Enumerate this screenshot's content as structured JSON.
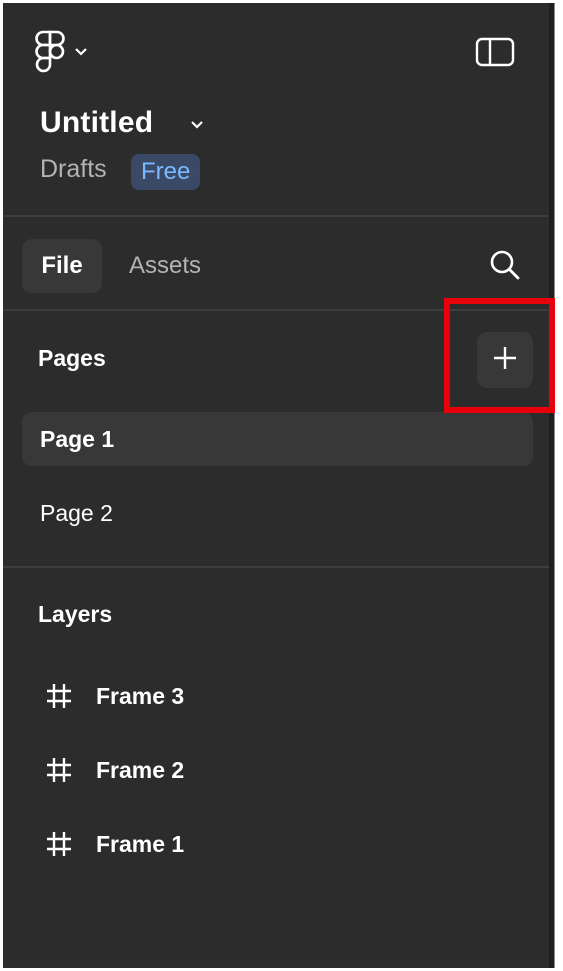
{
  "header": {
    "logo_icon": "figma-logo-icon",
    "menu_chevron_icon": "chevron-down-icon",
    "sidebar_toggle_icon": "sidebar-toggle-icon",
    "file_title": "Untitled",
    "title_chevron_icon": "chevron-down-icon",
    "location": "Drafts",
    "plan_badge": "Free"
  },
  "tabs": {
    "items": [
      {
        "label": "File",
        "active": true
      },
      {
        "label": "Assets",
        "active": false
      }
    ],
    "search_icon": "search-icon"
  },
  "pages": {
    "title": "Pages",
    "add_icon": "plus-icon",
    "items": [
      {
        "label": "Page 1",
        "selected": true
      },
      {
        "label": "Page 2",
        "selected": false
      }
    ]
  },
  "layers": {
    "title": "Layers",
    "items": [
      {
        "label": "Frame 3",
        "icon": "frame-icon"
      },
      {
        "label": "Frame 2",
        "icon": "frame-icon"
      },
      {
        "label": "Frame 1",
        "icon": "frame-icon"
      }
    ]
  },
  "colors": {
    "panel_bg": "#2c2c2c",
    "selected_bg": "#383838",
    "badge_bg": "#3a4a66",
    "badge_text": "#7cb8ff",
    "highlight": "#e8000b"
  }
}
